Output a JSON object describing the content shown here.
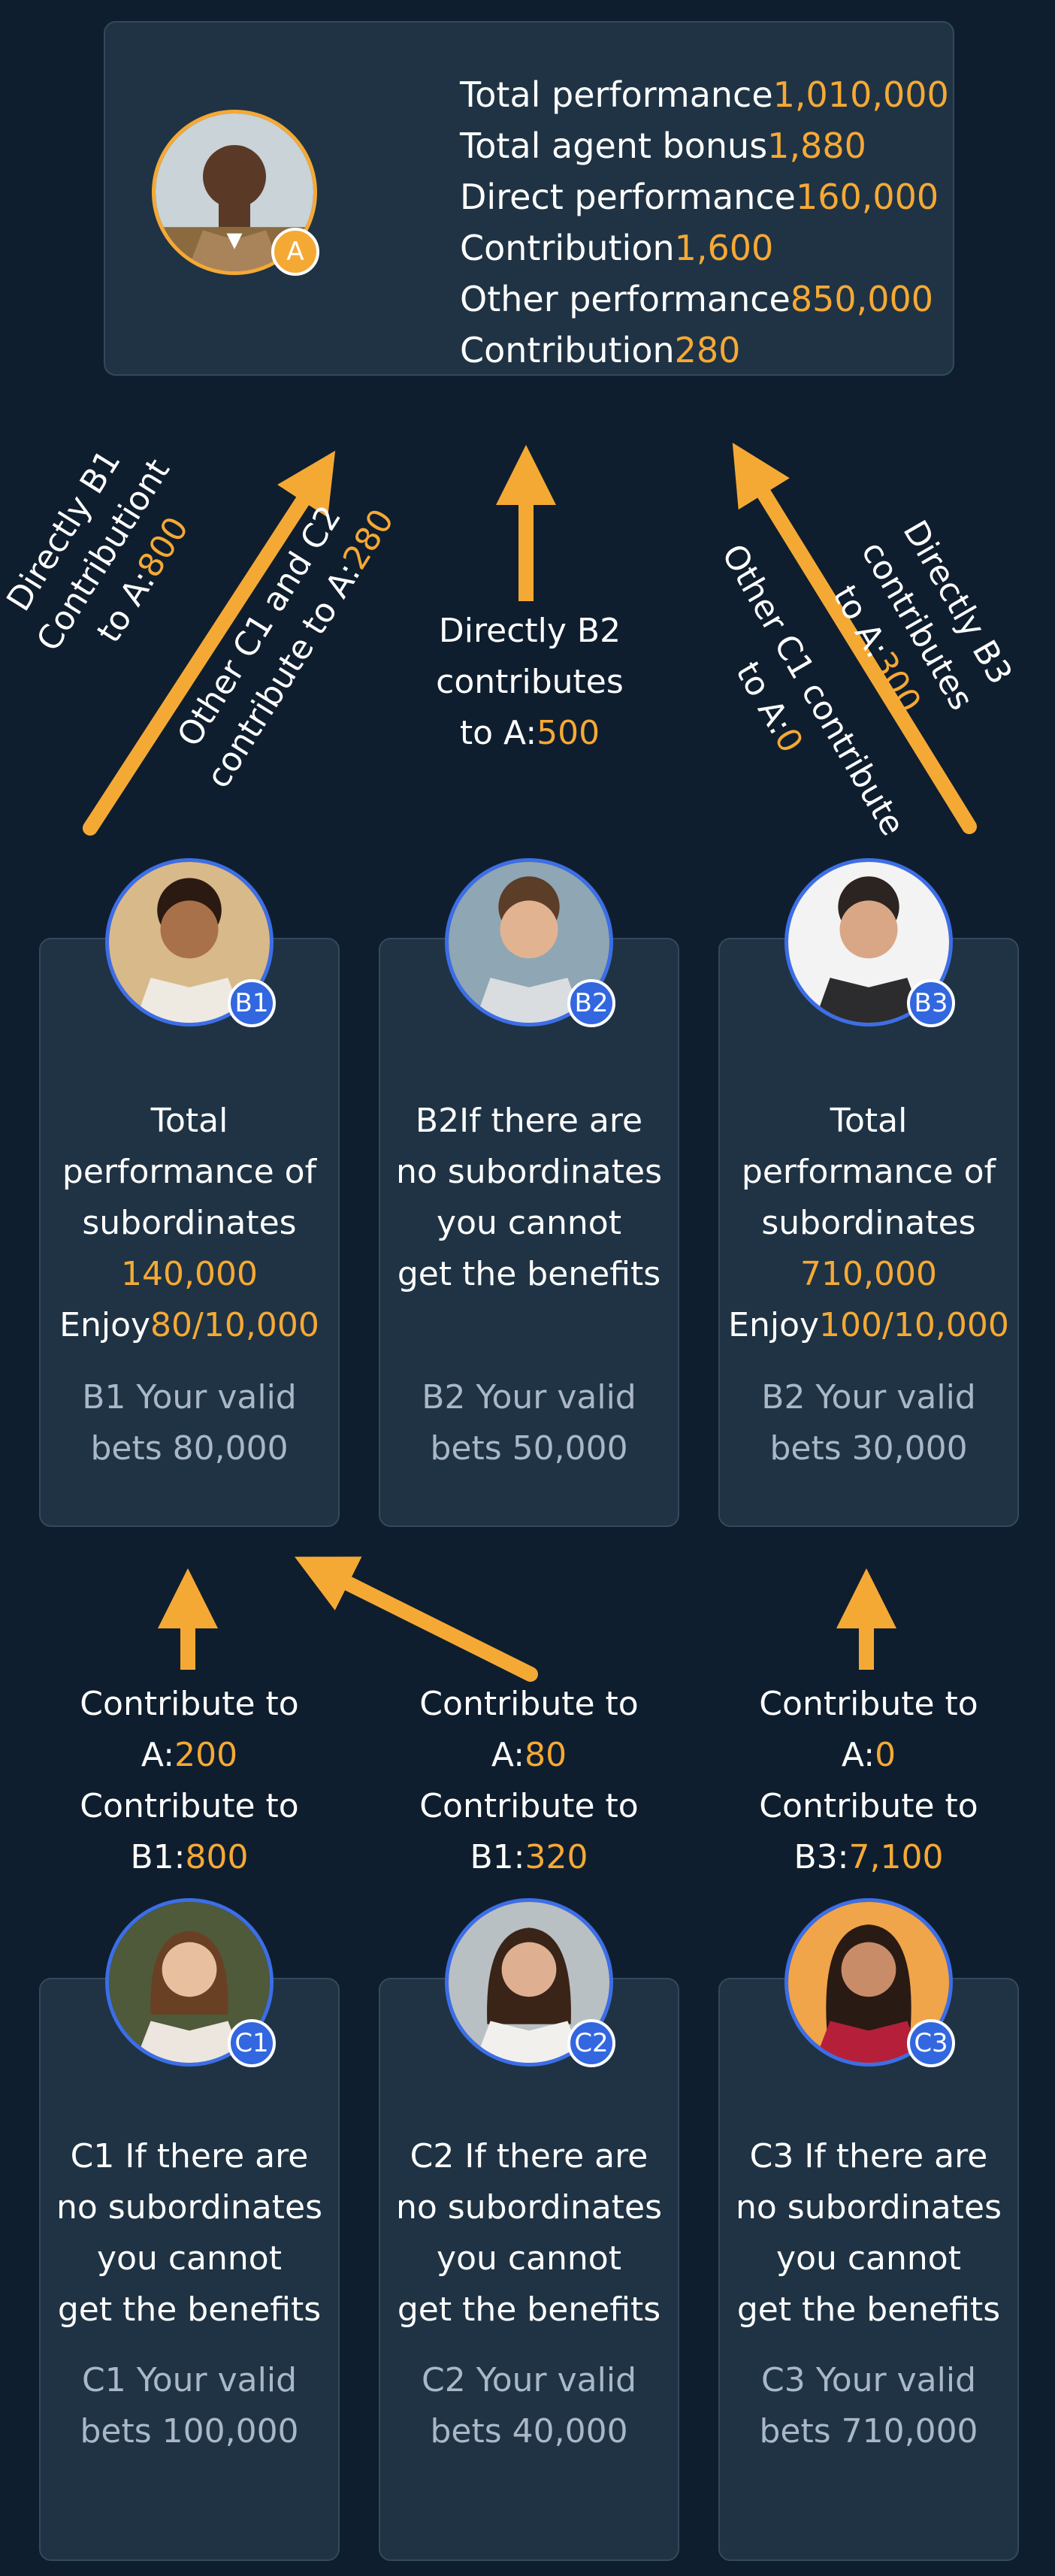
{
  "top": {
    "avatar_badge": "A",
    "stats": [
      {
        "label": "Total performance",
        "value": "1,010,000"
      },
      {
        "label": "Total agent bonus",
        "value": "1,880"
      },
      {
        "label": "Direct performance",
        "value": "160,000"
      },
      {
        "label": "Contribution",
        "value": "1,600"
      },
      {
        "label": "Other performance",
        "value": "850,000"
      },
      {
        "label": "Contribution",
        "value": "280"
      }
    ]
  },
  "arrow_labels": {
    "b1_direct": {
      "line1": "Directly B1",
      "line2": "Contributiont",
      "line3_prefix": "to A:",
      "value": "800"
    },
    "b1_other": {
      "line1": "Other C1 and C2",
      "line2_prefix": "contribute to A:",
      "value": "280"
    },
    "b2_direct": {
      "line1": "Directly B2",
      "line2": "contributes",
      "line3_prefix": "to A:",
      "value": "500"
    },
    "b3_other": {
      "line1": "Other C1 contribute",
      "line2_prefix": "to A:",
      "value": "0"
    },
    "b3_direct": {
      "line1": "Directly B3",
      "line2": "contributes",
      "line3_prefix": "to A:",
      "value": "300"
    }
  },
  "b_level": [
    {
      "badge": "B1",
      "lines": [
        "Total",
        "performance of",
        "subordinates"
      ],
      "highlight": "140,000",
      "enjoy_prefix": "Enjoy",
      "enjoy_value": "80/10,000",
      "bets": [
        "B1 Your valid",
        "bets 80,000"
      ]
    },
    {
      "badge": "B2",
      "lines": [
        "B2If there are",
        "no subordinates",
        "you cannot",
        "get the benefits"
      ],
      "bets": [
        "B2 Your valid",
        "bets 50,000"
      ]
    },
    {
      "badge": "B3",
      "lines": [
        "Total",
        "performance of",
        "subordinates"
      ],
      "highlight": "710,000",
      "enjoy_prefix": "Enjoy",
      "enjoy_value": "100/10,000",
      "bets": [
        "B2 Your valid",
        "bets 30,000"
      ]
    }
  ],
  "c_contrib": [
    {
      "a_prefix": "Contribute to",
      "a_label": "A:",
      "a_value": "200",
      "b_prefix": "Contribute to",
      "b_label": "B1:",
      "b_value": "800"
    },
    {
      "a_prefix": "Contribute to",
      "a_label": "A:",
      "a_value": "80",
      "b_prefix": "Contribute to",
      "b_label": "B1:",
      "b_value": "320"
    },
    {
      "a_prefix": "Contribute to",
      "a_label": "A:",
      "a_value": "0",
      "b_prefix": "Contribute to",
      "b_label": "B3:",
      "b_value": "7,100"
    }
  ],
  "c_level": [
    {
      "badge": "C1",
      "lines": [
        "C1 If there are",
        "no subordinates",
        "you cannot",
        "get the benefits"
      ],
      "bets": [
        "C1 Your valid",
        "bets 100,000"
      ]
    },
    {
      "badge": "C2",
      "lines": [
        "C2 If there are",
        "no subordinates",
        "you cannot",
        "get the benefits"
      ],
      "bets": [
        "C2 Your valid",
        "bets 40,000"
      ]
    },
    {
      "badge": "C3",
      "lines": [
        "C3 If there are",
        "no subordinates",
        "you cannot",
        "get the benefits"
      ],
      "bets": [
        "C3 Your valid",
        "bets 710,000"
      ]
    }
  ],
  "colors": {
    "background": "#0f1e2e",
    "card": "#1f3344",
    "accent": "#f5a935",
    "badge_blue": "#3267e0",
    "muted_text": "#a9b7c6"
  }
}
